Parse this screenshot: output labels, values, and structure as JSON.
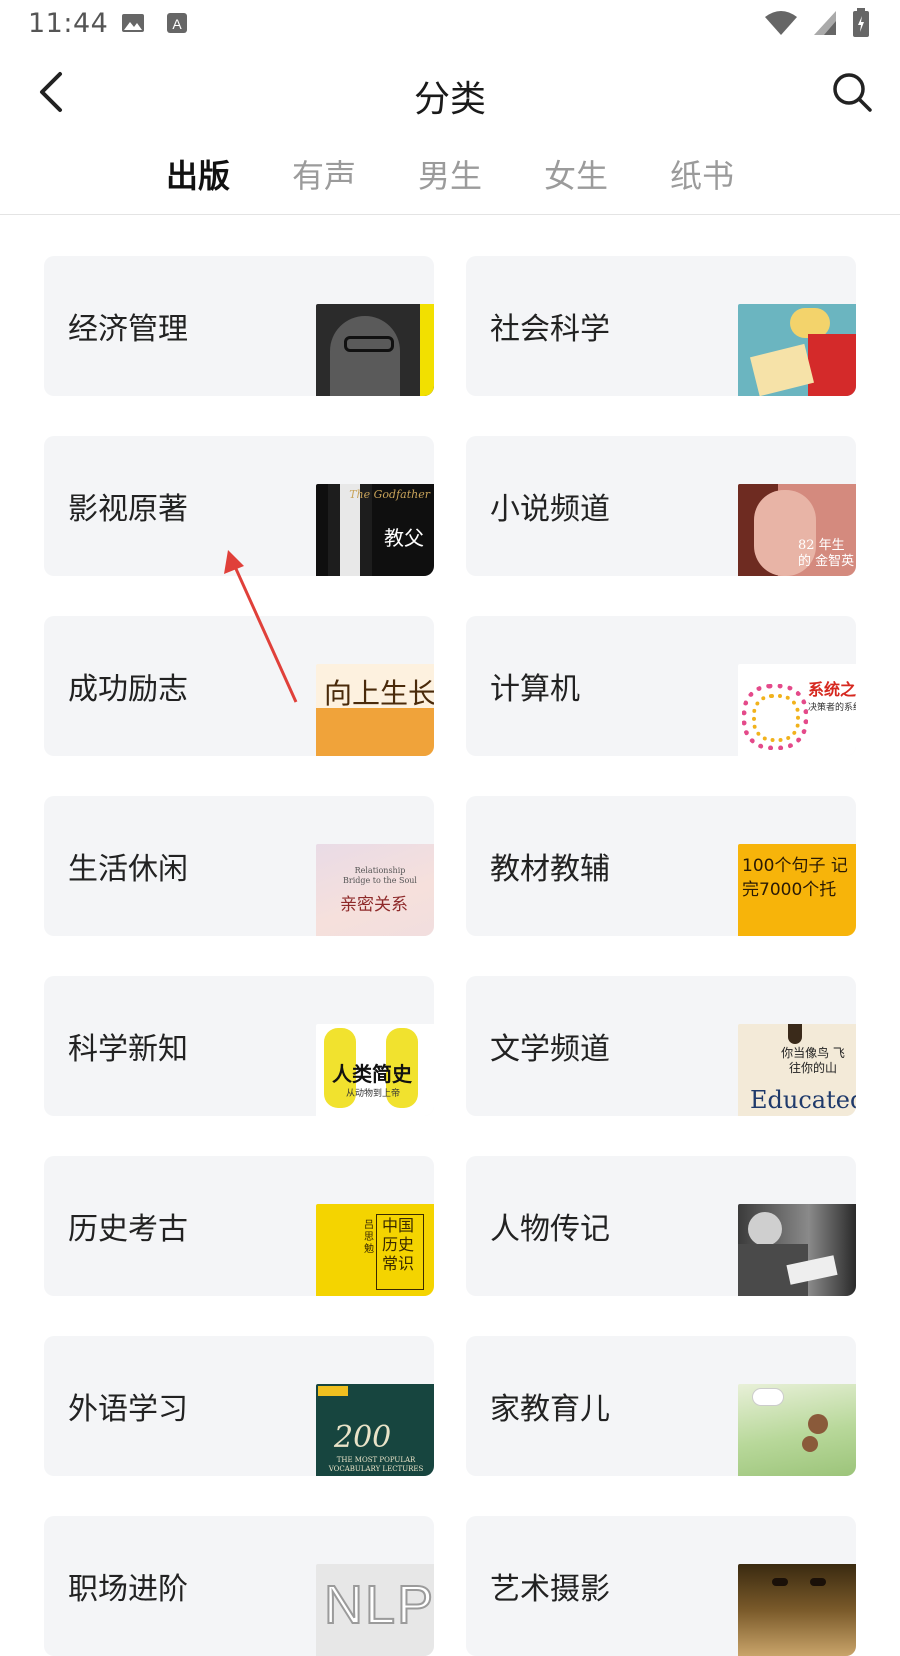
{
  "status_bar": {
    "time": "11:44"
  },
  "header": {
    "title": "分类"
  },
  "tabs": [
    {
      "label": "出版",
      "active": true
    },
    {
      "label": "有声",
      "active": false
    },
    {
      "label": "男生",
      "active": false
    },
    {
      "label": "女生",
      "active": false
    },
    {
      "label": "纸书",
      "active": false
    }
  ],
  "categories": [
    {
      "label": "经济管理",
      "cover": {
        "text": "",
        "bg": "#2b2b2b",
        "accent": "#f2e000"
      }
    },
    {
      "label": "社会科学",
      "cover": {
        "text": "",
        "bg": "#6bb5c0",
        "accent": "#f3d36b"
      }
    },
    {
      "label": "影视原著",
      "cover": {
        "text": "教父",
        "sub": "The Godfather",
        "bg": "#0f0f0f",
        "accent": "#c8a35a"
      }
    },
    {
      "label": "小说频道",
      "cover": {
        "text": "82 年生的 金智英",
        "bg": "#d48a7e",
        "accent": "#ffffff"
      }
    },
    {
      "label": "成功励志",
      "cover": {
        "text": "向上生长",
        "bg": "#f0a33a",
        "accent": "#fdf1df"
      }
    },
    {
      "label": "计算机",
      "cover": {
        "text": "系统之美",
        "sub": "决策者的系统思考",
        "bg": "#ffffff",
        "accent": "#d6281f"
      }
    },
    {
      "label": "生活休闲",
      "cover": {
        "text": "亲密关系",
        "sub": "Relationship Bridge to the Soul",
        "bg": "#f1dede",
        "accent": "#8e2a2a"
      }
    },
    {
      "label": "教材教辅",
      "cover": {
        "text": "100个句子 记完7000个托",
        "bg": "#f7b40a",
        "accent": "#2a1a05"
      }
    },
    {
      "label": "科学新知",
      "cover": {
        "text": "人类简史",
        "sub": "从动物到上帝",
        "bg": "#ffffff",
        "accent": "#f1e22e"
      }
    },
    {
      "label": "文学频道",
      "cover": {
        "text": "你当像鸟 飞往你的山",
        "sub": "Educated",
        "bg": "#f3ead8",
        "accent": "#1f3a6b"
      }
    },
    {
      "label": "历史考古",
      "cover": {
        "text": "中国 历史常识",
        "sub": "吕思勉",
        "bg": "#f4d400",
        "accent": "#3a2a00"
      }
    },
    {
      "label": "人物传记",
      "cover": {
        "text": "",
        "bg": "#6d6d6d",
        "accent": "#d8d8d8"
      }
    },
    {
      "label": "外语学习",
      "cover": {
        "text": "200",
        "sub": "THE MOST POPULAR VOCABULARY LECTURES",
        "bg": "#17453f",
        "accent": "#e9e3c8"
      }
    },
    {
      "label": "家教育儿",
      "cover": {
        "text": "",
        "bg": "#b8d89a",
        "accent": "#ffffff"
      }
    },
    {
      "label": "职场进阶",
      "cover": {
        "text": "NLP",
        "bg": "#e7e7e7",
        "accent": "#9b9b9b"
      }
    },
    {
      "label": "艺术摄影",
      "cover": {
        "text": "",
        "bg": "#7a5a2a",
        "accent": "#c9a46a"
      }
    }
  ]
}
